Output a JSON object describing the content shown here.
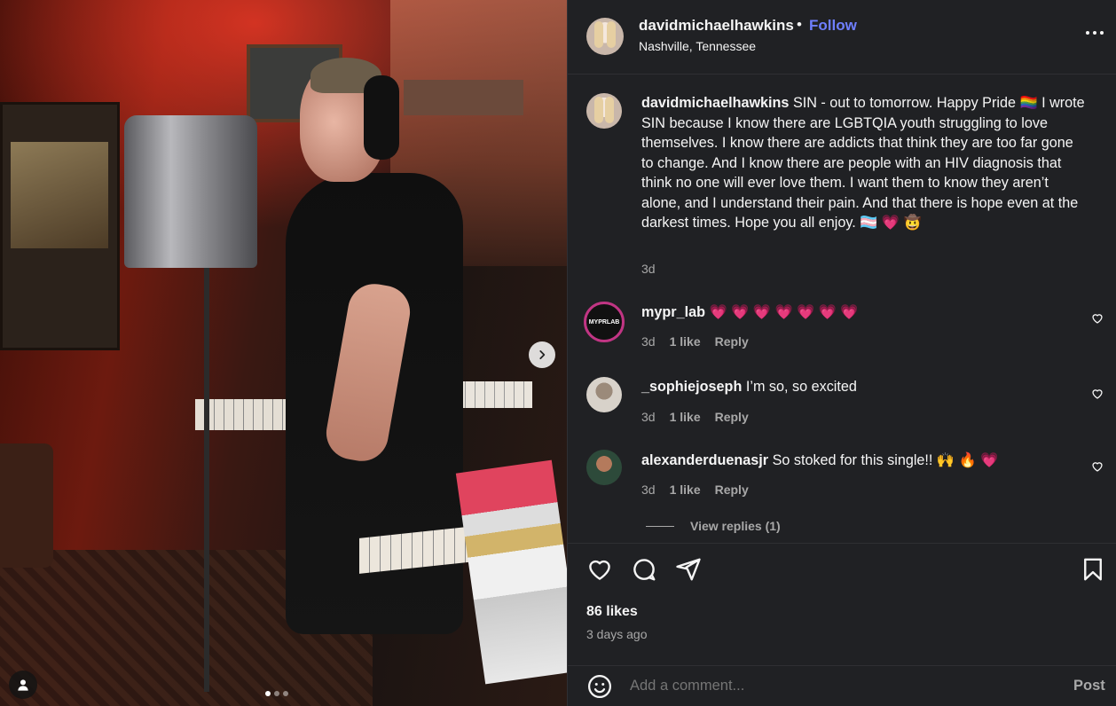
{
  "post": {
    "username": "davidmichaelhawkins",
    "separator": "•",
    "follow_label": "Follow",
    "location": "Nashville, Tennessee",
    "caption_username": "davidmichaelhawkins",
    "caption_text": "SIN - out to tomorrow. Happy Pride 🏳️‍🌈 I wrote SIN because I know there are LGBTQIA youth struggling to love themselves. I know there are addicts that think they are too far gone to change. And I know there are people with an HIV diagnosis that think no one will ever love them. I want them to know they aren’t alone, and I understand their pain. And that there is hope even at the darkest times. Hope you all enjoy. 🏳️‍⚧️ 💗 🤠",
    "caption_time": "3d"
  },
  "comments": [
    {
      "username": "mypr_lab",
      "text": "💗 💗 💗 💗 💗 💗 💗",
      "time": "3d",
      "likes": "1 like",
      "reply_label": "Reply",
      "avatar_text": "MYPRLAB"
    },
    {
      "username": "_sophiejoseph",
      "text": "I’m so, so excited",
      "time": "3d",
      "likes": "1 like",
      "reply_label": "Reply"
    },
    {
      "username": "alexanderduenasjr",
      "text": "So stoked for this single!! 🙌 🔥 💗",
      "time": "3d",
      "likes": "1 like",
      "reply_label": "Reply"
    }
  ],
  "view_replies_label": "View replies (1)",
  "likes_count": "86 likes",
  "posted_ago": "3 days ago",
  "add_comment": {
    "placeholder": "Add a comment...",
    "post_label": "Post"
  },
  "carousel": {
    "slides": 3,
    "active_index": 0
  },
  "colors": {
    "accent": "#6f7fff",
    "background": "#202124",
    "muted": "#a8a8a8"
  },
  "icons": [
    "more-icon",
    "heart-icon",
    "comment-icon",
    "share-icon",
    "bookmark-icon",
    "emoji-icon",
    "chevron-right-icon",
    "user-tag-icon"
  ]
}
